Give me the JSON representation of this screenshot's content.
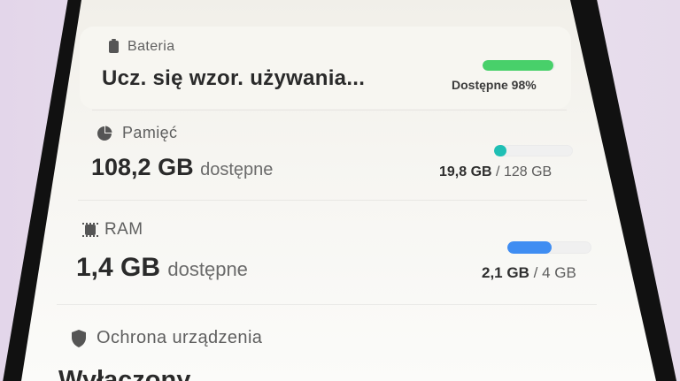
{
  "battery": {
    "label": "Bateria",
    "status": "Ucz. się wzor. używania...",
    "available_text": "Dostępne 98%",
    "percent": 98,
    "color": "#48d06a"
  },
  "storage": {
    "label": "Pamięć",
    "available_value": "108,2 GB",
    "available_suffix": "dostępne",
    "used": "19,8 GB",
    "separator": "/",
    "total": "128 GB",
    "used_fraction": 0.155,
    "color": "#1fbfb4"
  },
  "ram": {
    "label": "RAM",
    "available_value": "1,4 GB",
    "available_suffix": "dostępne",
    "used": "2,1 GB",
    "separator": "/",
    "total": "4 GB",
    "used_fraction": 0.525,
    "color": "#3f8df2"
  },
  "protection": {
    "label": "Ochrona urządzenia",
    "status": "Wyłączony"
  },
  "icons": {
    "battery": "battery-icon",
    "storage": "pie-chart-icon",
    "ram": "chip-icon",
    "protection": "shield-icon"
  }
}
